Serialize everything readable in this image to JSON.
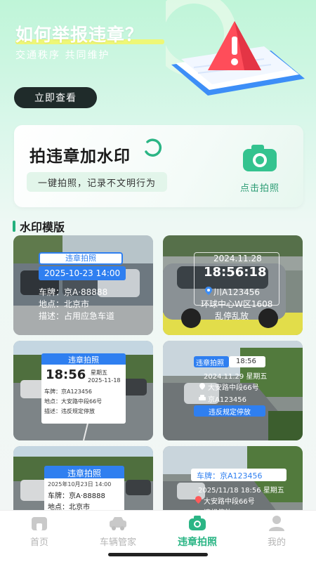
{
  "hero": {
    "title": "如何举报违章？",
    "subtitle": "交通秩序  共同维护",
    "button": "立即查看"
  },
  "watermark_card": {
    "title": "拍违章加水印",
    "tagline": "一键拍照，记录不文明行为",
    "camera_label": "点击拍照"
  },
  "section": {
    "title": "水印模版"
  },
  "templates": [
    {
      "header": "违章拍照",
      "datetime": "2025-10-23 14:00",
      "rows": [
        "车牌：京A·88888",
        "地点：北京市",
        "描述：占用应急车道"
      ]
    },
    {
      "date": "2024.11.28",
      "time": "18:56:18",
      "plate": "川A123456",
      "location": "环球中心W区1608",
      "desc": "乱停乱放"
    },
    {
      "header": "违章拍照",
      "time": "18:56",
      "weekday": "星期五",
      "date": "2025-11-18",
      "rows": [
        "车牌：京A123456",
        "地点：大安路中段66号",
        "描述：违反规定停放"
      ]
    },
    {
      "header": "违章拍照",
      "time": "18:56",
      "datetime": "2024.11.29 星期五",
      "location": "大安路中段66号",
      "plate": "京A123456",
      "footer": "违反规定停放"
    },
    {
      "header": "违章拍照",
      "datetime": "2025年10月23日 14:00",
      "rows": [
        "车牌：京A·88888",
        "地点：北京市"
      ]
    },
    {
      "plate_line": "车牌：京A123456",
      "datetime": "2025/11/18 18:56 星期五",
      "location": "大安路中段66号",
      "partial": "违规停放"
    }
  ],
  "tabs": [
    {
      "label": "首页",
      "icon": "home-icon"
    },
    {
      "label": "车辆管家",
      "icon": "car-icon"
    },
    {
      "label": "违章拍照",
      "icon": "camera-icon",
      "active": true
    },
    {
      "label": "我的",
      "icon": "user-icon"
    }
  ],
  "colors": {
    "accent": "#2bb585",
    "tab_inactive": "#b5b5b5",
    "watermark_blue": "#2f7ff0"
  }
}
